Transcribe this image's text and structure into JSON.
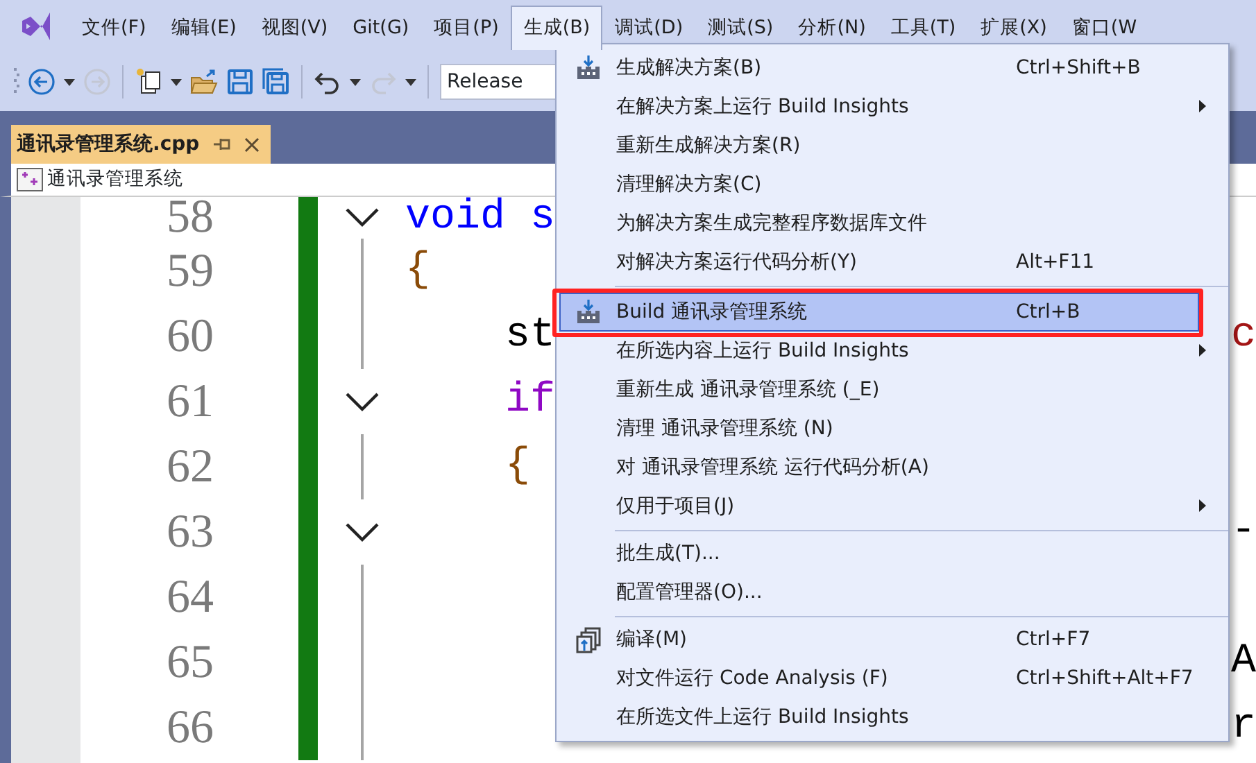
{
  "menubar": [
    {
      "label": "文件(F)",
      "selected": false
    },
    {
      "label": "编辑(E)",
      "selected": false
    },
    {
      "label": "视图(V)",
      "selected": false
    },
    {
      "label": "Git(G)",
      "selected": false
    },
    {
      "label": "项目(P)",
      "selected": false
    },
    {
      "label": "生成(B)",
      "selected": true
    },
    {
      "label": "调试(D)",
      "selected": false
    },
    {
      "label": "测试(S)",
      "selected": false
    },
    {
      "label": "分析(N)",
      "selected": false
    },
    {
      "label": "工具(T)",
      "selected": false
    },
    {
      "label": "扩展(X)",
      "selected": false
    },
    {
      "label": "窗口(W",
      "selected": false
    }
  ],
  "toolbar": {
    "configuration": "Release",
    "buttons": [
      {
        "kind": "back",
        "disabled": false
      },
      {
        "kind": "forward",
        "disabled": true
      },
      {
        "kind": "new",
        "disabled": false
      },
      {
        "kind": "open",
        "disabled": false
      },
      {
        "kind": "save",
        "disabled": false
      },
      {
        "kind": "saveall",
        "disabled": false
      },
      {
        "kind": "undo",
        "disabled": false
      },
      {
        "kind": "redo",
        "disabled": true
      }
    ]
  },
  "document_tab": {
    "title": "通讯录管理系统.cpp",
    "selected": true
  },
  "navigation": {
    "project": "通讯录管理系统"
  },
  "editor": {
    "lines": [
      {
        "number": "58",
        "foldable": true,
        "changed": true,
        "code": [
          {
            "text": "void s",
            "kind": "keyword"
          }
        ]
      },
      {
        "number": "59",
        "foldable": false,
        "changed": true,
        "code": [
          {
            "text": "{",
            "kind": "brace"
          }
        ]
      },
      {
        "number": "60",
        "foldable": false,
        "changed": true,
        "code": [
          {
            "text": "    st",
            "kind": "plain"
          }
        ],
        "trailing": [
          {
            "text": "c",
            "kind": "string"
          }
        ]
      },
      {
        "number": "61",
        "foldable": true,
        "changed": true,
        "code": [
          {
            "text": "    if",
            "kind": "control"
          }
        ]
      },
      {
        "number": "62",
        "foldable": false,
        "changed": true,
        "code": [
          {
            "text": "    {",
            "kind": "brace"
          }
        ]
      },
      {
        "number": "63",
        "foldable": true,
        "changed": true,
        "trailing": [
          {
            "text": "-",
            "kind": "plain"
          }
        ]
      },
      {
        "number": "64",
        "foldable": false,
        "changed": true
      },
      {
        "number": "65",
        "foldable": false,
        "changed": true,
        "trailing": [
          {
            "text": "A",
            "kind": "plain"
          }
        ]
      },
      {
        "number": "66",
        "foldable": false,
        "changed": true,
        "trailing": [
          {
            "text": "r",
            "kind": "plain"
          }
        ]
      }
    ]
  },
  "build_menu": {
    "items": [
      {
        "kind": "build",
        "label": "生成解决方案(B)",
        "shortcut": "Ctrl+Shift+B",
        "submenu": false,
        "selected": false,
        "annotated": false
      },
      {
        "kind": "plain",
        "label": "在解决方案上运行 Build Insights",
        "submenu": true,
        "selected": false,
        "annotated": false
      },
      {
        "kind": "plain",
        "label": "重新生成解决方案(R)",
        "submenu": false,
        "selected": false,
        "annotated": false
      },
      {
        "kind": "plain",
        "label": "清理解决方案(C)",
        "submenu": false,
        "selected": false,
        "annotated": false
      },
      {
        "kind": "plain",
        "label": "为解决方案生成完整程序数据库文件",
        "submenu": false,
        "selected": false,
        "annotated": false
      },
      {
        "kind": "plain",
        "label": "对解决方案运行代码分析(Y)",
        "shortcut": "Alt+F11",
        "submenu": false,
        "selected": false,
        "annotated": false
      },
      {
        "kind": "separator"
      },
      {
        "kind": "build",
        "label": "Build 通讯录管理系统",
        "shortcut": "Ctrl+B",
        "submenu": false,
        "selected": true,
        "annotated": true
      },
      {
        "kind": "plain",
        "label": "在所选内容上运行 Build Insights",
        "submenu": true,
        "selected": false,
        "annotated": false
      },
      {
        "kind": "plain",
        "label": "重新生成 通讯录管理系统 (_E)",
        "submenu": false,
        "selected": false,
        "annotated": false
      },
      {
        "kind": "plain",
        "label": "清理 通讯录管理系统 (N)",
        "submenu": false,
        "selected": false,
        "annotated": false
      },
      {
        "kind": "plain",
        "label": "对 通讯录管理系统 运行代码分析(A)",
        "submenu": false,
        "selected": false,
        "annotated": false
      },
      {
        "kind": "plain",
        "label": "仅用于项目(J)",
        "submenu": true,
        "selected": false,
        "annotated": false
      },
      {
        "kind": "separator"
      },
      {
        "kind": "plain",
        "label": "批生成(T)...",
        "submenu": false,
        "selected": false,
        "annotated": false
      },
      {
        "kind": "plain",
        "label": "配置管理器(O)...",
        "submenu": false,
        "selected": false,
        "annotated": false
      },
      {
        "kind": "separator"
      },
      {
        "kind": "compile",
        "label": "编译(M)",
        "shortcut": "Ctrl+F7",
        "submenu": false,
        "selected": false,
        "annotated": false
      },
      {
        "kind": "plain",
        "label": "对文件运行 Code Analysis (F)",
        "shortcut": "Ctrl+Shift+Alt+F7",
        "submenu": false,
        "selected": false,
        "annotated": false
      },
      {
        "kind": "plain",
        "label": "在所选文件上运行 Build Insights",
        "submenu": false,
        "selected": false,
        "annotated": false
      }
    ]
  }
}
